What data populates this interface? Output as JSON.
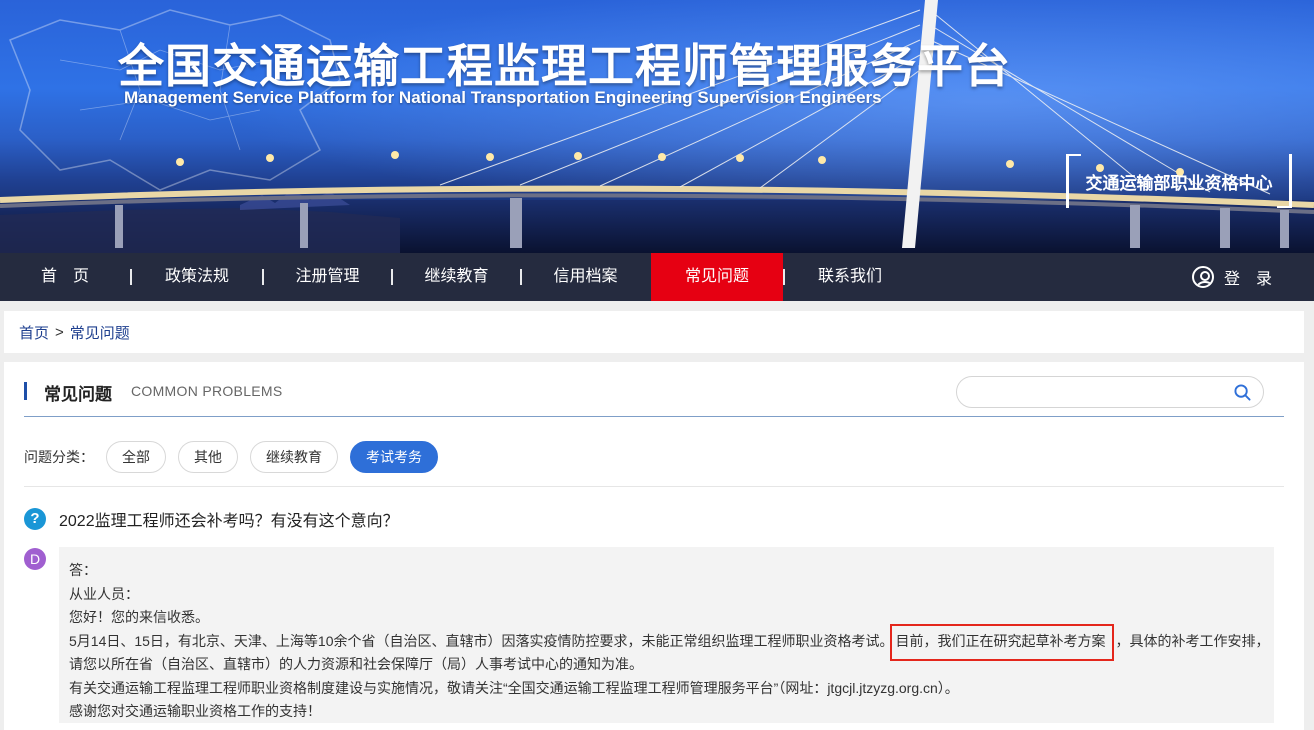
{
  "banner": {
    "title_cn": "全国交通运输工程监理工程师管理服务平台",
    "title_en": "Management Service Platform for National Transportation Engineering Supervision Engineers",
    "org": "交通运输部职业资格中心"
  },
  "nav": {
    "items": [
      {
        "label": "首　页"
      },
      {
        "label": "政策法规"
      },
      {
        "label": "注册管理"
      },
      {
        "label": "继续教育"
      },
      {
        "label": "信用档案"
      },
      {
        "label": "常见问题"
      },
      {
        "label": "联系我们"
      }
    ],
    "active": "常见问题",
    "login": "登　录"
  },
  "breadcrumb": {
    "home": "首页",
    "separator": ">",
    "current": "常见问题"
  },
  "section": {
    "title": "常见问题",
    "subtitle": "COMMON PROBLEMS"
  },
  "search": {
    "value": "",
    "placeholder": ""
  },
  "filter": {
    "label": "问题分类：",
    "chips": [
      {
        "label": "全部"
      },
      {
        "label": "其他"
      },
      {
        "label": "继续教育"
      },
      {
        "label": "考试考务"
      }
    ],
    "active": "考试考务"
  },
  "question": {
    "icon": "?",
    "text": "2022监理工程师还会补考吗？有没有这个意向？"
  },
  "answer": {
    "icon": "D",
    "lines": [
      "答：",
      "从业人员：",
      "您好！您的来信收悉。"
    ],
    "line4_before": "5月14日、15日，有北京、天津、上海等10余个省（自治区、直辖市）因落实疫情防控要求，未能正常组织监理工程师职业资格考试。",
    "line4_highlight": "目前，我们正在研究起草补考方案",
    "line4_after": "，具体的补考工作安排，",
    "line5": "请您以所在省（自治区、直辖市）的人力资源和社会保障厅（局）人事考试中心的通知为准。",
    "line6": "有关交通运输工程监理工程师职业资格制度建设与实施情况，敬请关注“全国交通运输工程监理工程师管理服务平台”（网址：jtgcjl.jtzyzg.org.cn）。",
    "line7": "感谢您对交通运输职业资格工作的支持！"
  },
  "colors": {
    "nav_active": "#e60012",
    "chip_active": "#2e6fd8",
    "question_icon": "#1a96d6",
    "answer_icon": "#a05fd0",
    "highlight_border": "#e4261b"
  }
}
